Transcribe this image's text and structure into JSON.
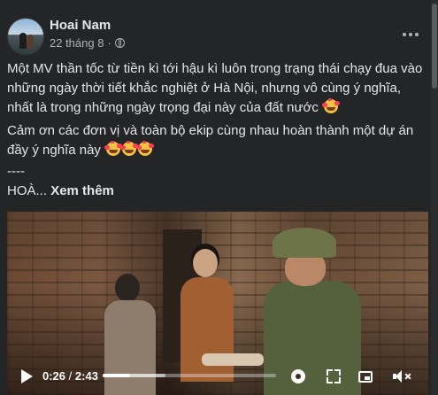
{
  "author": {
    "name": "Hoai Nam"
  },
  "post_meta": {
    "date": "22 tháng 8",
    "separator": "·",
    "audience_icon": "globe-icon"
  },
  "menu": {
    "icon": "more-options-icon"
  },
  "content": {
    "paragraph_1": "Một MV thần tốc từ tiền kì tới hậu kì luôn trong trạng thái chạy đua vào những ngày thời tiết khắc nghiệt ở Hà Nội, nhưng vô cùng ý nghĩa, nhất là trong những ngày trọng đại này của đất nước",
    "paragraph_2": "Cảm ơn các đơn vị và toàn bộ ekip cùng nhau hoàn thành một dự án đầy ý nghĩa này",
    "separator": "----",
    "paragraph_3": "HOÀ...",
    "see_more_label": "Xem thêm",
    "emoji_name": "smiling-face-with-hearts-emoji"
  },
  "video": {
    "current_time": "0:26",
    "time_separator": "/",
    "duration": "2:43",
    "progress_fraction": 0.16,
    "buffered_fraction": 0.36,
    "icons": [
      "play-icon",
      "settings-icon",
      "fullscreen-icon",
      "picture-in-picture-icon",
      "muted-icon"
    ]
  },
  "colors": {
    "background": "#242526",
    "text_primary": "#e4e6eb",
    "text_secondary": "#b0b3b8"
  }
}
